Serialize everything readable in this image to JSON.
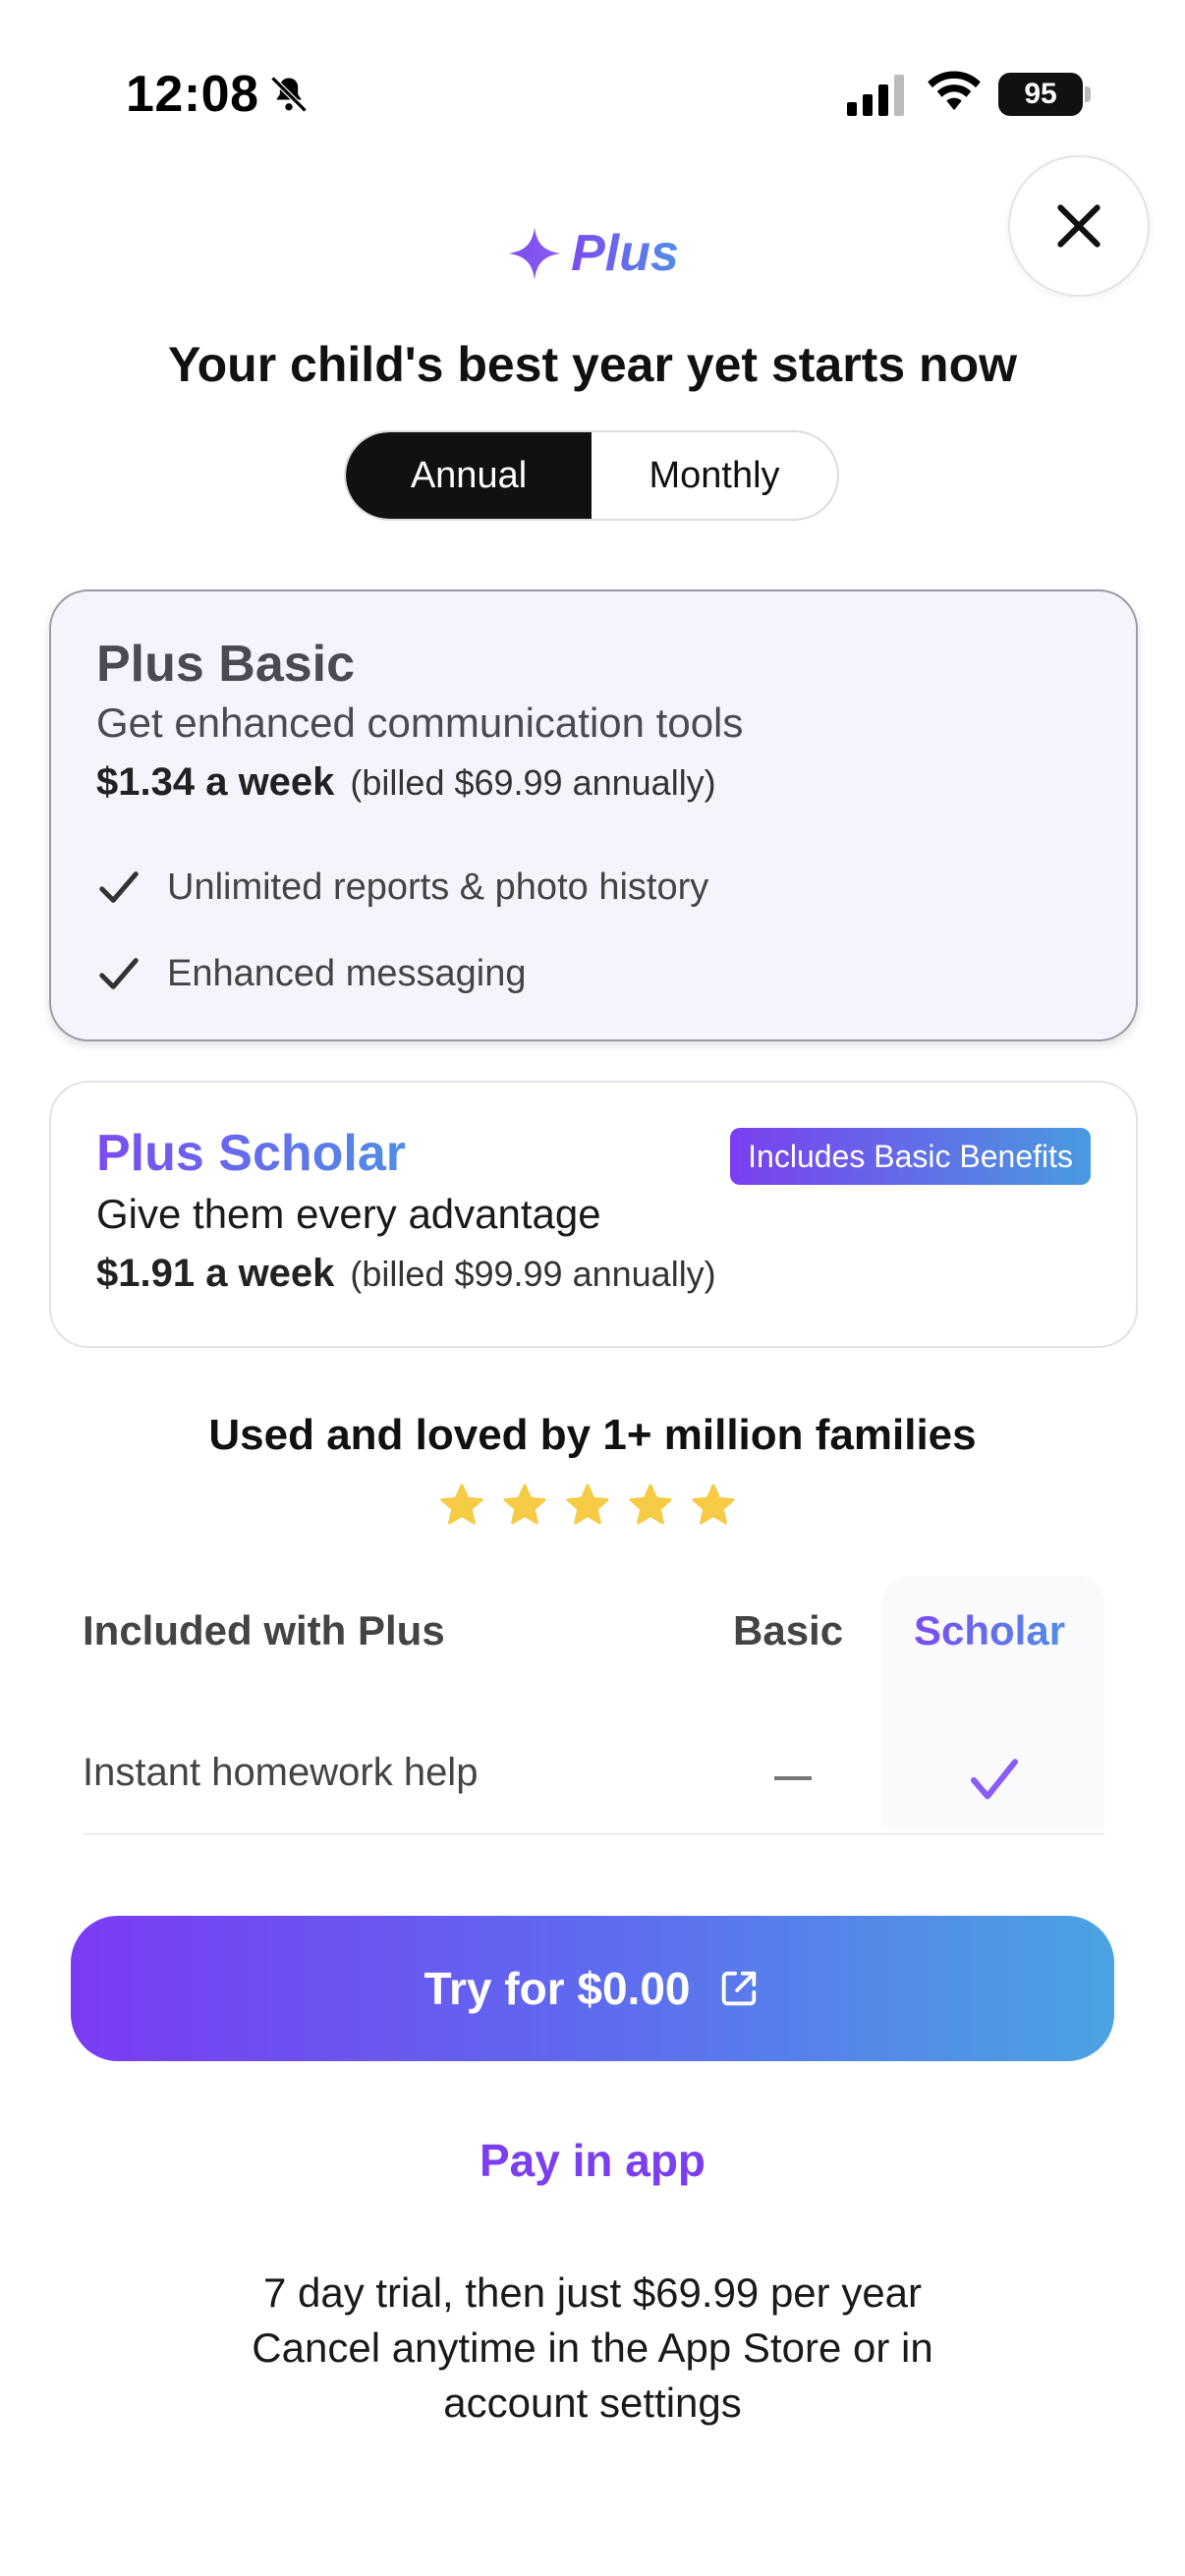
{
  "status_bar": {
    "time": "12:08",
    "battery": "95"
  },
  "header": {
    "brand": "Plus",
    "headline": "Your child's best year yet starts now"
  },
  "billing_toggle": {
    "options": [
      "Annual",
      "Monthly"
    ],
    "selected": "Annual"
  },
  "plans": [
    {
      "name": "Plus Basic",
      "tagline": "Get enhanced communication tools",
      "price": "$1.34 a week",
      "billed": "(billed $69.99 annually)",
      "features": [
        "Unlimited reports & photo history",
        "Enhanced messaging"
      ],
      "selected": true
    },
    {
      "name": "Plus Scholar",
      "tagline": "Give them every advantage",
      "price": "$1.91 a week",
      "billed": "(billed $99.99 annually)",
      "badge": "Includes Basic Benefits",
      "selected": false
    }
  ],
  "social_proof": {
    "text": "Used and loved by 1+ million families",
    "stars": 5
  },
  "comparison": {
    "header": "Included with Plus",
    "columns": [
      "Basic",
      "Scholar"
    ],
    "rows": [
      {
        "label": "Instant homework help",
        "basic": "—",
        "scholar": "check"
      }
    ]
  },
  "cta": {
    "label": "Try for $0.00"
  },
  "pay_in_app": "Pay in app",
  "terms": {
    "line1": "7 day trial, then just $69.99 per year",
    "line2": "Cancel anytime in the App Store or in",
    "line3": "account settings"
  },
  "colors": {
    "accent_purple": "#7b3ff0",
    "accent_blue": "#4aa3e2",
    "star": "#f6cb45"
  }
}
